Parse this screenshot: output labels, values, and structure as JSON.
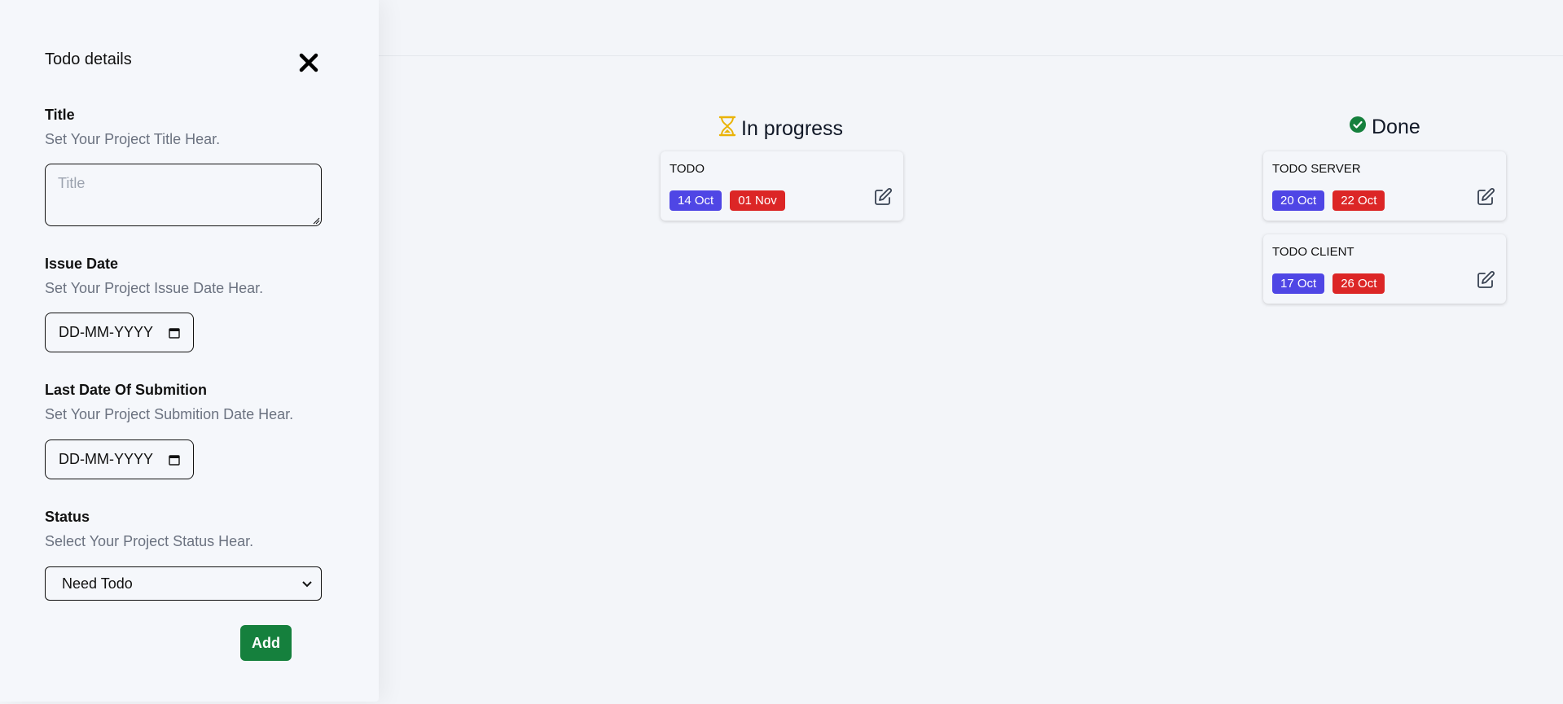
{
  "drawer": {
    "title": "Todo details",
    "fields": {
      "title": {
        "label": "Title",
        "hint": "Set Your Project Title Hear.",
        "placeholder": "Title"
      },
      "issue_date": {
        "label": "Issue Date",
        "hint": "Set Your Project Issue Date Hear.",
        "value": "DD-MM-YYYY"
      },
      "last_date": {
        "label": "Last Date Of Submition",
        "hint": "Set Your Project Submition Date Hear.",
        "value": "DD-MM-YYYY"
      },
      "status": {
        "label": "Status",
        "hint": "Select Your Project Status Hear.",
        "selected": "Need Todo"
      }
    },
    "add_label": "Add"
  },
  "board": {
    "columns": [
      {
        "name": "In progress",
        "icon": "hourglass-icon",
        "icon_color": "#eab308",
        "cards": [
          {
            "title": "TODO",
            "start": "14 Oct",
            "end": "01 Nov"
          }
        ]
      },
      {
        "name": "Done",
        "icon": "check-circle-icon",
        "icon_color": "#15803d",
        "cards": [
          {
            "title": "TODO SERVER",
            "start": "20 Oct",
            "end": "22 Oct"
          },
          {
            "title": "TODO CLIENT",
            "start": "17 Oct",
            "end": "26 Oct"
          }
        ]
      }
    ]
  },
  "colors": {
    "start_badge": "#4f46e5",
    "end_badge": "#dc2626",
    "add_button": "#15803d",
    "background": "#f3f5f9"
  }
}
